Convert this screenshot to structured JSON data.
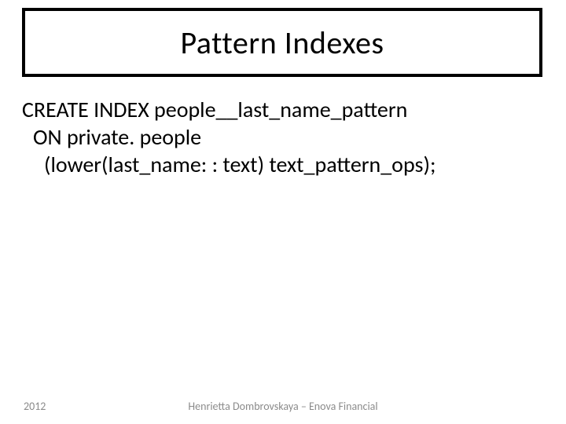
{
  "title": "Pattern Indexes",
  "code": {
    "line1": "CREATE INDEX people__last_name_pattern",
    "line2": "ON private. people",
    "line3": "(lower(last_name: : text) text_pattern_ops);"
  },
  "footer": {
    "year": "2012",
    "credit": "Henrietta Dombrovskaya – Enova Financial"
  }
}
